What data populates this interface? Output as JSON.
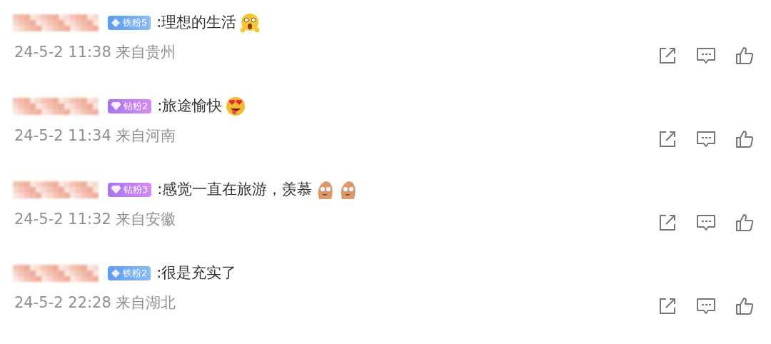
{
  "comments": [
    {
      "badge": {
        "kind": "iron",
        "label": "铁粉5"
      },
      "text": ":理想的生活",
      "emojis": [
        {
          "kind": "shocked"
        }
      ],
      "meta": "24-5-2 11:38 来自贵州"
    },
    {
      "badge": {
        "kind": "diamond",
        "label": "钻粉2"
      },
      "text": ":旅途愉快",
      "emojis": [
        {
          "kind": "heart-eyes"
        }
      ],
      "meta": "24-5-2 11:34 来自河南"
    },
    {
      "badge": {
        "kind": "diamond",
        "label": "钻粉3"
      },
      "text": ":感觉一直在旅游，羡慕",
      "emojis": [
        {
          "kind": "creature"
        },
        {
          "kind": "creature"
        }
      ],
      "meta": "24-5-2 11:32 来自安徽"
    },
    {
      "badge": {
        "kind": "iron",
        "label": "铁粉2"
      },
      "text": ":很是充实了",
      "meta": "24-5-2 22:28 来自湖北"
    }
  ]
}
